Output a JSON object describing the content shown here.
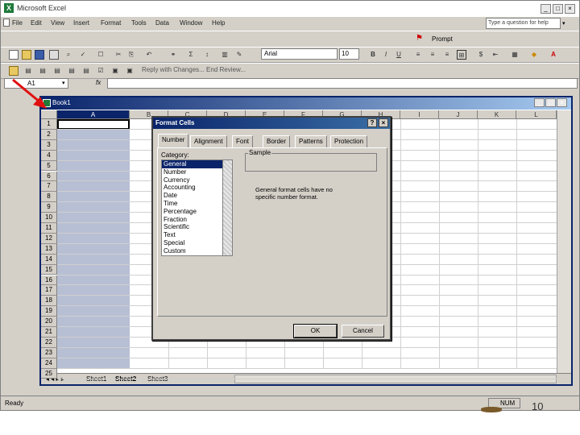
{
  "app": {
    "title": "Microsoft Excel",
    "menu": [
      "File",
      "Edit",
      "View",
      "Insert",
      "Format",
      "Tools",
      "Data",
      "Window",
      "Help"
    ],
    "help_placeholder": "Type a question for help",
    "prompt_label": "Prompt",
    "font_name": "Arial",
    "font_size": "10",
    "review_text": "Reply with Changes...  End Review...",
    "name_box": "A1",
    "fx": "fx",
    "status": "Ready",
    "num": "NUM"
  },
  "workbook": {
    "title": "Book1",
    "columns": [
      "A",
      "B",
      "C",
      "D",
      "E",
      "F",
      "G",
      "H",
      "I",
      "J",
      "K",
      "L"
    ],
    "rows": [
      "1",
      "2",
      "3",
      "4",
      "5",
      "6",
      "7",
      "8",
      "9",
      "10",
      "11",
      "12",
      "13",
      "14",
      "15",
      "16",
      "17",
      "18",
      "19",
      "20",
      "21",
      "22",
      "23",
      "24",
      "25"
    ],
    "sheets": [
      "Sheet1",
      "Sheet2",
      "Sheet3"
    ]
  },
  "dialog": {
    "title": "Format Cells",
    "tabs": [
      "Number",
      "Alignment",
      "Font",
      "Border",
      "Patterns",
      "Protection"
    ],
    "category_label": "Category:",
    "categories": [
      "General",
      "Number",
      "Currency",
      "Accounting",
      "Date",
      "Time",
      "Percentage",
      "Fraction",
      "Scientific",
      "Text",
      "Special",
      "Custom"
    ],
    "selected_category": "General",
    "sample_label": "Sample",
    "description": "General format cells have no specific number format.",
    "ok": "OK",
    "cancel": "Cancel"
  },
  "slide_number": "10",
  "colors": {
    "titlebar": "#0a246a",
    "selection": "#b7bfd4",
    "chrome": "#d4d0c8",
    "arrow": "#e01010"
  }
}
